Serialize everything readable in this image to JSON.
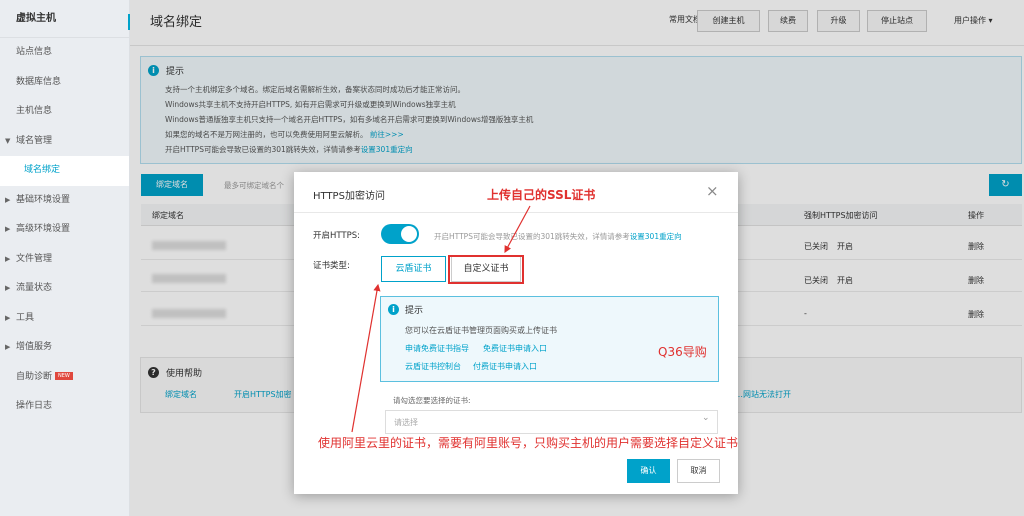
{
  "sidebar": {
    "brand": "虚拟主机",
    "items": [
      {
        "label": "站点信息",
        "caret": ""
      },
      {
        "label": "数据库信息",
        "caret": ""
      },
      {
        "label": "主机信息",
        "caret": ""
      },
      {
        "label": "域名管理",
        "caret": "▼"
      },
      {
        "label": "域名绑定",
        "caret": ""
      },
      {
        "label": "基础环境设置",
        "caret": "▶"
      },
      {
        "label": "高级环境设置",
        "caret": "▶"
      },
      {
        "label": "文件管理",
        "caret": "▶"
      },
      {
        "label": "流量状态",
        "caret": "▶"
      },
      {
        "label": "工具",
        "caret": "▶"
      },
      {
        "label": "增值服务",
        "caret": "▶"
      },
      {
        "label": "自助诊断",
        "caret": "",
        "badge": "NEW"
      },
      {
        "label": "操作日志",
        "caret": ""
      }
    ]
  },
  "header": {
    "title": "域名绑定",
    "doc_link": "常用文档",
    "buttons": [
      "创建主机",
      "续费",
      "升级",
      "停止站点"
    ],
    "user_ops": "用户操作 ▾"
  },
  "tip": {
    "title": "提示",
    "lines": [
      "支持一个主机绑定多个域名。绑定后域名需解析生效，备案状态同时成功后才能正常访问。",
      "Windows共享主机不支持开启HTTPS, 如有开启需求可升级或更换到Windows独享主机",
      "Windows普通版独享主机只支持一个域名开启HTTPS，如有多域名开启需求可更换到Windows增强版独享主机",
      "如果您的域名不是万网注册的，也可以免费使用阿里云解析。",
      "开启HTTPS可能会导致已设置的301跳转失效，详情请参考"
    ],
    "line4_link": "前往>>>",
    "line5_link": "设置301重定向"
  },
  "table": {
    "bind_button": "绑定域名",
    "bind_hint": "最多可绑定域名个",
    "refresh_icon": "↻",
    "columns": [
      "绑定域名",
      "强制HTTPS加密访问",
      "操作"
    ],
    "rows": [
      {
        "https": "已关闭",
        "enable": "开启",
        "action": "删除"
      },
      {
        "https": "已关闭",
        "enable": "开启",
        "action": "删除"
      },
      {
        "https": "-",
        "enable": "",
        "action": "删除"
      }
    ]
  },
  "help": {
    "title": "使用帮助",
    "links": [
      "绑定域名",
      "开启HTTPS加密",
      "…网站无法打开"
    ]
  },
  "modal": {
    "title": "HTTPS加密访问",
    "https_label": "开启HTTPS:",
    "https_on": true,
    "https_hint_prefix": "开启HTTPS可能会导致已设置的301跳转失效，详情请参考",
    "https_hint_link": "设置301重定向",
    "cert_type_label": "证书类型:",
    "cert_tabs": [
      "云盾证书",
      "自定义证书"
    ],
    "inner_tip": {
      "title": "提示",
      "line1": "您可以在云盾证书管理页面购买或上传证书",
      "link1a": "申请免费证书指导",
      "link1b": "免费证书申请入口",
      "link2a": "云盾证书控制台",
      "link2b": "付费证书申请入口"
    },
    "select_label": "请勾选您要选择的证书:",
    "select_placeholder": "请选择",
    "ok": "确认",
    "cancel": "取消"
  },
  "annotations": {
    "top": "上传自己的SSL证书",
    "right": "Q36导购",
    "bottom": "使用阿里云里的证书，需要有阿里账号，只购买主机的用户需要选择自定义证书"
  },
  "colors": {
    "accent": "#00a2ca",
    "annotation": "#e0312f"
  }
}
